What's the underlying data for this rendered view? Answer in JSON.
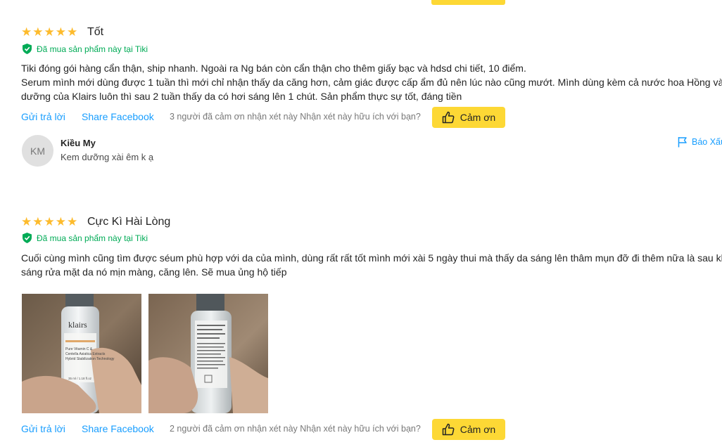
{
  "colors": {
    "star": "#fdbb2d",
    "verified": "#00ab56",
    "link": "#189eff",
    "button": "#fdd835"
  },
  "reviews": [
    {
      "rating": 5,
      "title": "Tốt",
      "verified": "Đã mua sản phẩm này tại Tiki",
      "lines": [
        "Tiki đóng gói hàng cẩn thận, ship nhanh. Ngoài ra Ng bán còn cẩn thận cho thêm giấy bạc và hdsd chi tiết, 10 điểm.",
        "Serum mình mới dùng được 1 tuần thì mới chỉ nhận thấy da căng hơn, cảm giác được cấp ẩm đủ nên lúc nào cũng mướt. Mình dùng kèm cả nước hoa Hồng và",
        "dưỡng của Klairs luôn thì sau 2 tuần thấy da có hơi sáng lên 1 chút. Sản phẩm thực sự tốt, đáng tiền"
      ],
      "reply_label": "Gửi trả lời",
      "share_label": "Share Facebook",
      "thanks_count": "3 người đã cảm ơn nhận xét này Nhận xét này hữu ích với bạn?",
      "thanks_label": "Cảm ơn",
      "comment": {
        "initials": "KM",
        "name": "Kiều My",
        "text": "Kem dưỡng xài êm k ạ",
        "report_label": "Báo Xấu"
      }
    },
    {
      "rating": 5,
      "title": "Cực Kì Hài Lòng",
      "verified": "Đã mua sản phẩm này tại Tiki",
      "lines": [
        "Cuối cùng mình cũng tìm được séum phù hợp với da của mình, dùng rất rất tốt mình mới xài 5 ngày thui mà thấy da sáng lên thâm mụn đỡ đi thêm nữa là sau khi",
        "sáng rửa mặt da nó mịn màng, căng lên. Sẽ mua ủng hộ tiếp"
      ],
      "photos": [
        {
          "brand": "klairs",
          "label_lines": [
            "Pure Vitamin C &",
            "Centella Asiatica Extracts",
            "Hybrid Stabilization Technology"
          ],
          "volume": "35 ml / 1.18 fl.oz"
        },
        {
          "back": true
        }
      ],
      "reply_label": "Gửi trả lời",
      "share_label": "Share Facebook",
      "thanks_count": "2 người đã cảm ơn nhận xét này Nhận xét này hữu ích với bạn?",
      "thanks_label": "Cảm ơn"
    }
  ]
}
